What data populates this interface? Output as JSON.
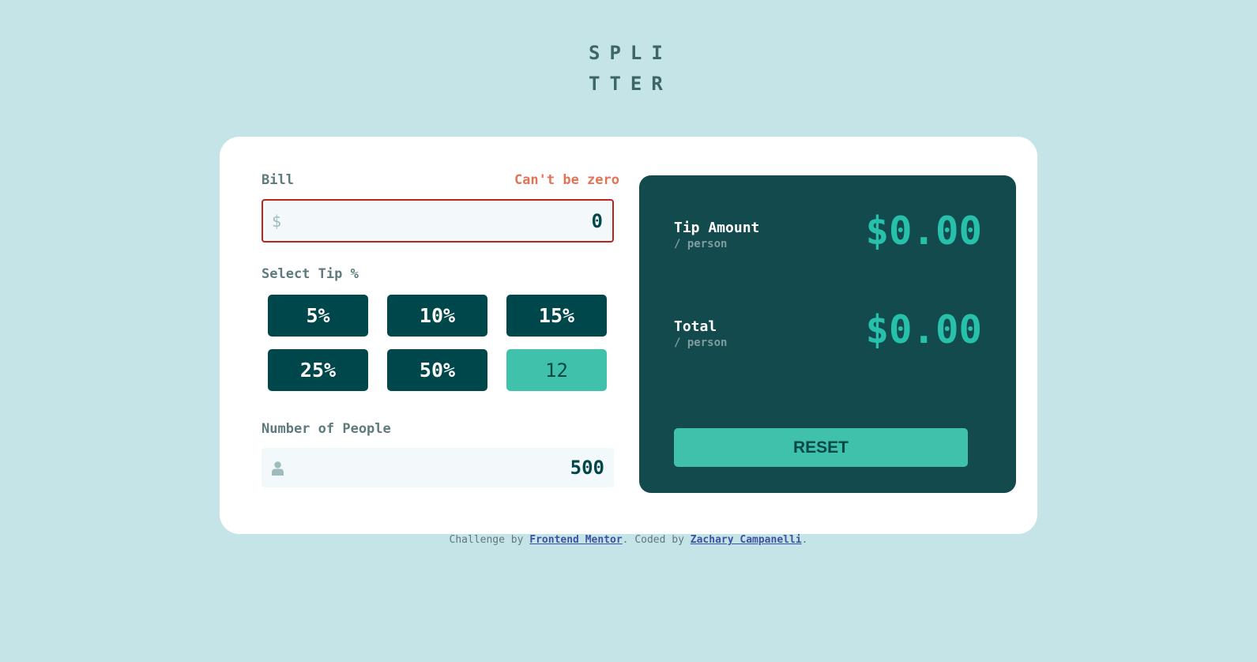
{
  "logo": {
    "line1": "SPLI",
    "line2": "TTER"
  },
  "bill": {
    "label": "Bill",
    "error": "Can't be zero",
    "currency_icon": "dollar-icon",
    "currency_symbol": "$",
    "value": "0"
  },
  "tip": {
    "label": "Select Tip %",
    "options": [
      "5%",
      "10%",
      "15%",
      "25%",
      "50%"
    ],
    "custom_value": "12"
  },
  "people": {
    "label": "Number of People",
    "icon": "person-icon",
    "value": "500"
  },
  "results": {
    "tip_amount": {
      "title": "Tip Amount",
      "sub": "/ person",
      "value": "$0.00"
    },
    "total": {
      "title": "Total",
      "sub": "/ person",
      "value": "$0.00"
    },
    "reset_label": "RESET"
  },
  "footer": {
    "prefix": "Challenge by ",
    "link1": "Frontend Mentor",
    "middle": ". Coded by ",
    "link2": "Zachary Campanelli",
    "suffix": "."
  },
  "colors": {
    "background": "#c5e4e7",
    "dark_cyan": "#00474b",
    "accent": "#26c0ab",
    "error": "#e17457"
  }
}
